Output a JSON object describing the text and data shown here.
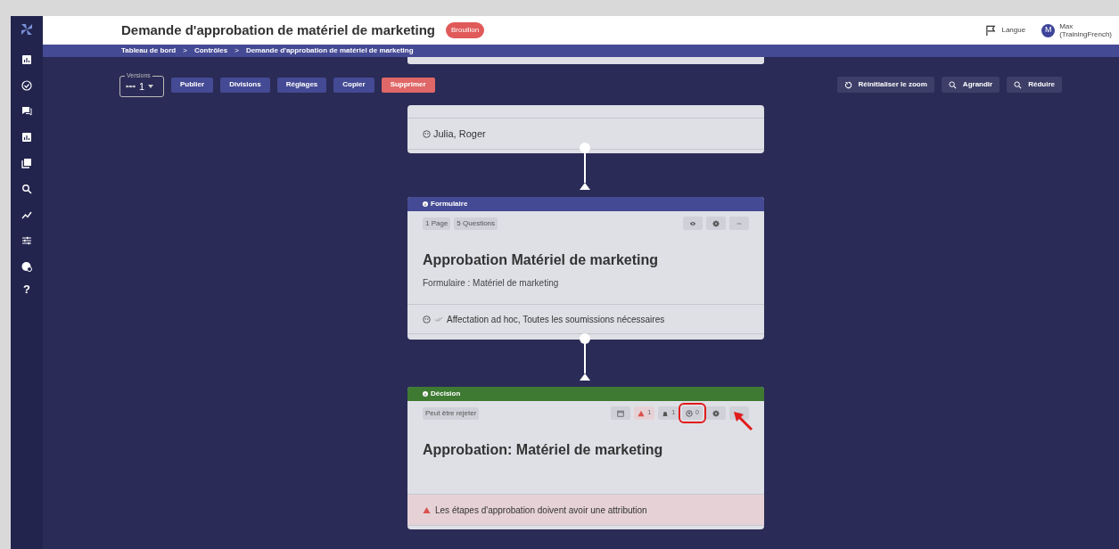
{
  "header": {
    "title": "Demande d'approbation de matériel de marketing",
    "status_badge": "Brouillon",
    "language": "Langue",
    "user_initial": "M",
    "user_name": "Max",
    "user_org": "(TrainingFrench)"
  },
  "breadcrumb": [
    "Tableau de bord",
    "Contrôles",
    "Demande d'approbation de matériel de marketing"
  ],
  "breadcrumb_separator": ">",
  "sidebar": {
    "items": [
      {
        "kind": "chart"
      },
      {
        "kind": "check"
      },
      {
        "kind": "chat"
      },
      {
        "kind": "chart"
      },
      {
        "kind": "copy"
      },
      {
        "kind": "search"
      },
      {
        "kind": "trend"
      },
      {
        "kind": "sliders"
      },
      {
        "kind": "globe"
      },
      {
        "kind": "help",
        "glyph": "?"
      }
    ]
  },
  "toolbar": {
    "versions_label": "Versions",
    "version_value": "1",
    "buttons": [
      {
        "label": "Publier",
        "kind": "primary"
      },
      {
        "label": "Divisions",
        "kind": "primary"
      },
      {
        "label": "Réglages",
        "kind": "primary"
      },
      {
        "label": "Copier",
        "kind": "primary"
      },
      {
        "label": "Supprimer",
        "kind": "danger"
      }
    ],
    "zoom_buttons": [
      {
        "label": "Réinitialiser le zoom"
      },
      {
        "label": "Agrandir"
      },
      {
        "label": "Réduire"
      }
    ]
  },
  "nodes": [
    {
      "kind": "partial",
      "assignees": "Julia, Roger"
    },
    {
      "kind": "form",
      "header": "Formulaire",
      "chips": [
        "1 Page",
        "5 Questions"
      ],
      "title": "Approbation Matériel de marketing",
      "subtitle": "Formulaire : Matériel de marketing",
      "footer": "Affectation ad hoc, Toutes les soumissions nécessaires"
    },
    {
      "kind": "decision",
      "header": "Décision",
      "chips": [
        "Peut être rejeter"
      ],
      "warning_count": "1",
      "notification_count": "1",
      "assignee_count": "0",
      "assignee_count_highlighted": true,
      "title": "Approbation: Matériel de marketing",
      "warning": "Les étapes d'approbation doivent avoir une attribution"
    }
  ]
}
